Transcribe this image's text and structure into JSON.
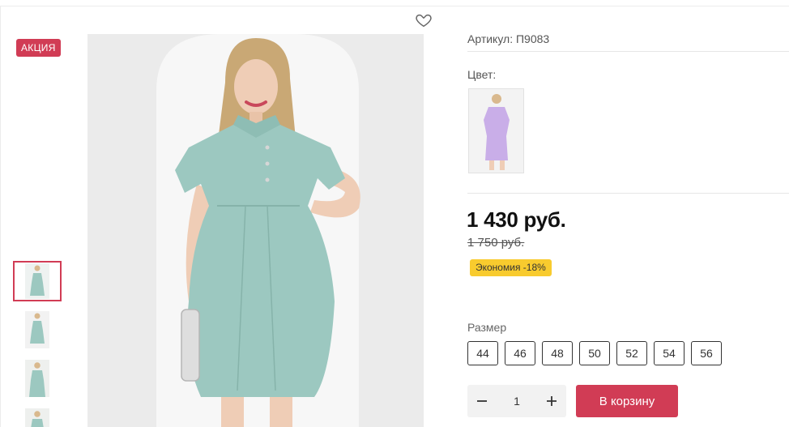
{
  "product": {
    "badge": "АКЦИЯ",
    "sku": "Артикул: П9083",
    "color_label": "Цвет:",
    "price": "1 430 руб.",
    "old_price": "1 750 руб.",
    "savings": "Экономия -18%",
    "size_label": "Размер",
    "sizes": [
      "44",
      "46",
      "48",
      "50",
      "52",
      "54",
      "56"
    ],
    "quantity": "1",
    "cart_button": "В корзину"
  },
  "colors": {
    "accent": "#d13c55",
    "savings_badge": "#f8cb2e",
    "dress_main": "#9cc8c0",
    "dress_alt": "#c9aee8"
  },
  "icons": {
    "favorite": "heart-icon",
    "decrease": "minus-icon",
    "increase": "plus-icon"
  }
}
